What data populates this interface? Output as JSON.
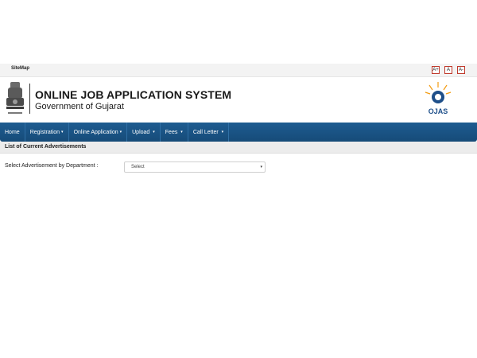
{
  "topbar": {
    "sitemap_label": "SiteMap",
    "font_controls": [
      "A+",
      "A",
      "A-"
    ]
  },
  "header": {
    "title": "ONLINE JOB APPLICATION SYSTEM",
    "subtitle": "Government of Gujarat",
    "logo_text": "OJAS"
  },
  "nav": {
    "items": [
      {
        "label": "Home",
        "caret": ""
      },
      {
        "label": "Registration",
        "caret": "▾"
      },
      {
        "label": "Online Application",
        "caret": "▾"
      },
      {
        "label": "Upload",
        "caret": "▾"
      },
      {
        "label": "Fees",
        "caret": "▾"
      },
      {
        "label": "Call Letter",
        "caret": "▾"
      }
    ]
  },
  "section": {
    "title": "List of Current Advertisements"
  },
  "filter": {
    "label": "Select Advertisement by Department :",
    "selected": "Select"
  },
  "colors": {
    "nav_bg": "#1a5485",
    "accent_red": "#c0392b",
    "ojas_blue": "#1e4f8a",
    "ojas_orange": "#f39c12"
  },
  "icons": {
    "emblem": "state-emblem-icon",
    "logo": "ojas-logo-icon",
    "caret": "chevron-down-icon"
  }
}
